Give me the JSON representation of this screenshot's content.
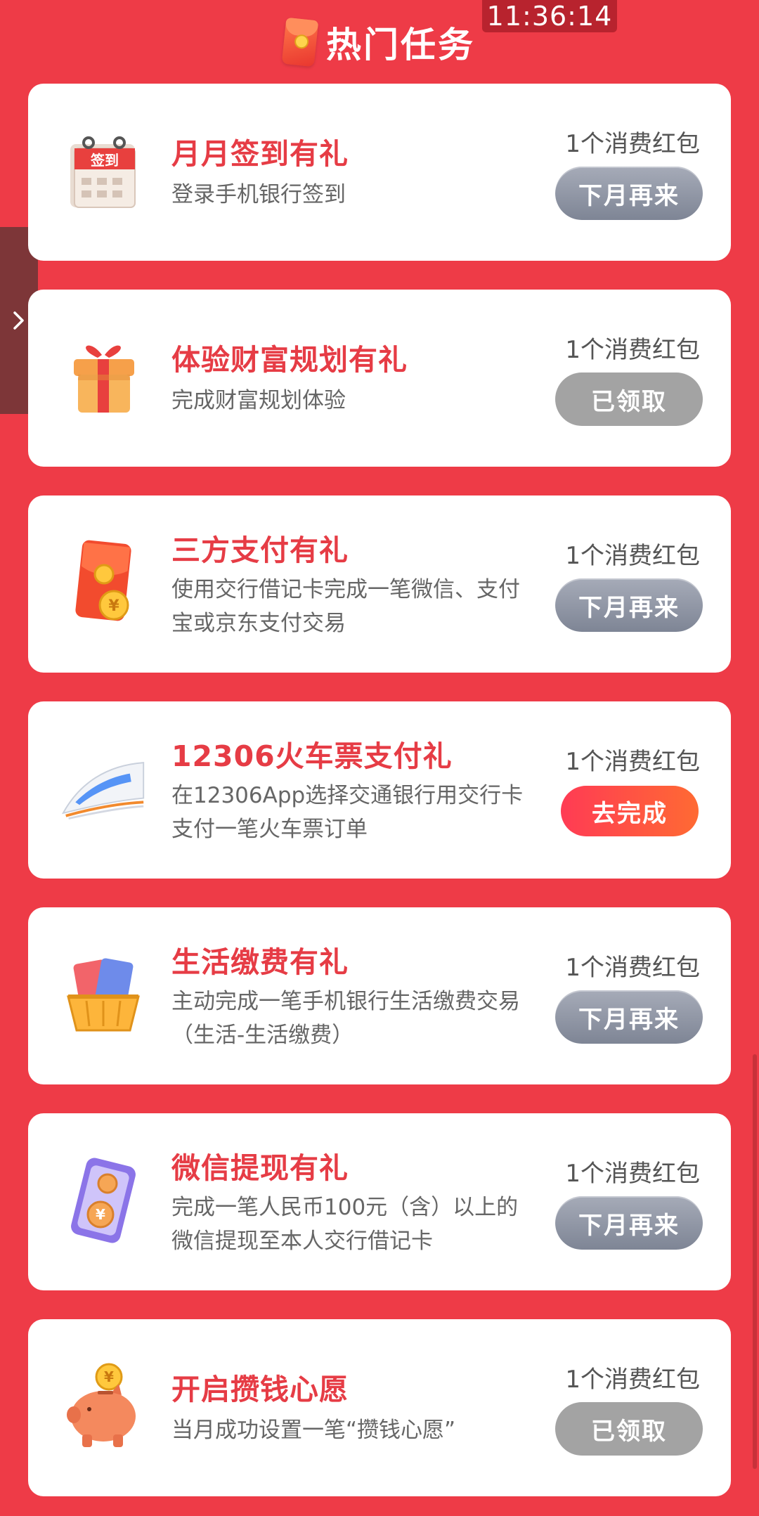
{
  "header": {
    "title": "热门任务",
    "time": "11:36:14"
  },
  "tasks": [
    {
      "title": "月月签到有礼",
      "desc": "登录手机银行签到",
      "reward": "1个消费红包",
      "button": "下月再来",
      "icon": "calendar-icon",
      "icon_text": "签到"
    },
    {
      "title": "体验财富规划有礼",
      "desc": "完成财富规划体验",
      "reward": "1个消费红包",
      "button": "已领取",
      "icon": "gift-box-icon"
    },
    {
      "title": "三方支付有礼",
      "desc": "使用交行借记卡完成一笔微信、支付宝或京东支付交易",
      "reward": "1个消费红包",
      "button": "下月再来",
      "icon": "red-envelope-icon"
    },
    {
      "title": "12306火车票支付礼",
      "desc": "在12306App选择交通银行用交行卡支付一笔火车票订单",
      "reward": "1个消费红包",
      "button": "去完成",
      "icon": "train-icon"
    },
    {
      "title": "生活缴费有礼",
      "desc": "主动完成一笔手机银行生活缴费交易（生活-生活缴费）",
      "reward": "1个消费红包",
      "button": "下月再来",
      "icon": "cards-basket-icon"
    },
    {
      "title": "微信提现有礼",
      "desc": "完成一笔人民币100元（含）以上的微信提现至本人交行借记卡",
      "reward": "1个消费红包",
      "button": "下月再来",
      "icon": "phone-coins-icon"
    },
    {
      "title": "开启攒钱心愿",
      "desc": "当月成功设置一笔“攒钱心愿”",
      "reward": "1个消费红包",
      "button": "已领取",
      "icon": "piggy-bank-icon"
    }
  ],
  "colors": {
    "background": "#EE3B47",
    "title_red": "#E63C45",
    "button_grey": "#8A90A0",
    "button_done": "#A3A3A3",
    "button_go": "#FF4A45"
  }
}
